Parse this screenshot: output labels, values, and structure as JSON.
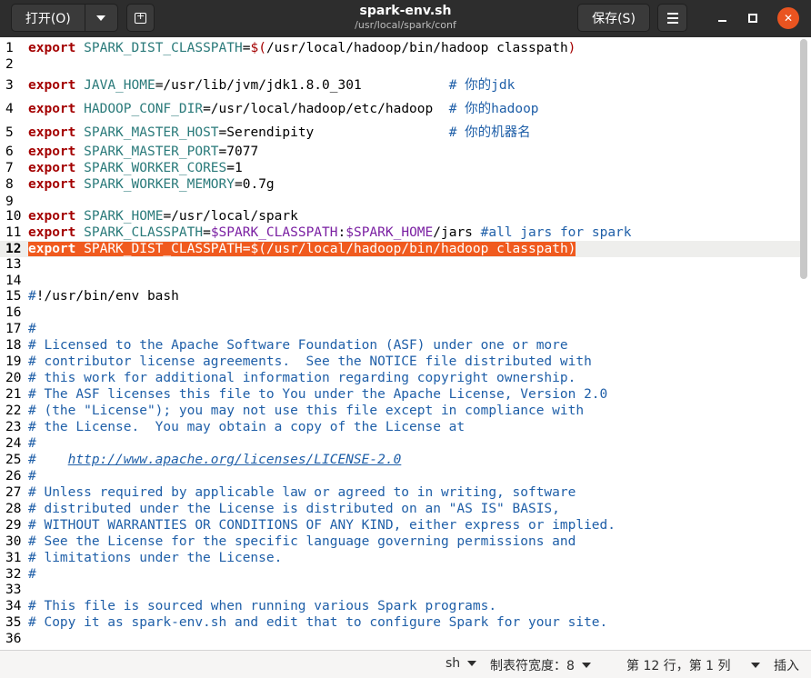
{
  "header": {
    "open_label": "打开(O)",
    "title": "spark-env.sh",
    "subtitle": "/usr/local/spark/conf",
    "save_label": "保存(S)"
  },
  "editor": {
    "current_line": 12,
    "lines": [
      {
        "n": "1",
        "segs": [
          [
            "kw",
            "export"
          ],
          [
            "",
            " "
          ],
          [
            "var",
            "SPARK_DIST_CLASSPATH"
          ],
          [
            "",
            "="
          ],
          [
            "sym",
            "$("
          ],
          [
            "",
            "/usr/local/hadoop/bin/hadoop classpath"
          ],
          [
            "sym",
            ")"
          ]
        ]
      },
      {
        "n": "2",
        "segs": []
      },
      {
        "n": "3",
        "segs": [
          [
            "kw",
            "export"
          ],
          [
            "",
            " "
          ],
          [
            "var",
            "JAVA_HOME"
          ],
          [
            "",
            "=/usr/lib/jvm/jdk1.8.0_301           "
          ],
          [
            "cmt",
            "# 你的jdk"
          ]
        ]
      },
      {
        "n": "4",
        "segs": [
          [
            "kw",
            "export"
          ],
          [
            "",
            " "
          ],
          [
            "var",
            "HADOOP_CONF_DIR"
          ],
          [
            "",
            "=/usr/local/hadoop/etc/hadoop  "
          ],
          [
            "cmt",
            "# 你的hadoop"
          ]
        ]
      },
      {
        "n": "5",
        "segs": [
          [
            "kw",
            "export"
          ],
          [
            "",
            " "
          ],
          [
            "var",
            "SPARK_MASTER_HOST"
          ],
          [
            "",
            "=Serendipity                 "
          ],
          [
            "cmt",
            "# 你的机器名"
          ]
        ]
      },
      {
        "n": "6",
        "segs": [
          [
            "kw",
            "export"
          ],
          [
            "",
            " "
          ],
          [
            "var",
            "SPARK_MASTER_PORT"
          ],
          [
            "",
            "=7077"
          ]
        ]
      },
      {
        "n": "7",
        "segs": [
          [
            "kw",
            "export"
          ],
          [
            "",
            " "
          ],
          [
            "var",
            "SPARK_WORKER_CORES"
          ],
          [
            "",
            "=1"
          ]
        ]
      },
      {
        "n": "8",
        "segs": [
          [
            "kw",
            "export"
          ],
          [
            "",
            " "
          ],
          [
            "var",
            "SPARK_WORKER_MEMORY"
          ],
          [
            "",
            "=0.7g"
          ]
        ]
      },
      {
        "n": "9",
        "segs": []
      },
      {
        "n": "10",
        "segs": [
          [
            "kw",
            "export"
          ],
          [
            "",
            " "
          ],
          [
            "var",
            "SPARK_HOME"
          ],
          [
            "",
            "=/usr/local/spark"
          ]
        ]
      },
      {
        "n": "11",
        "segs": [
          [
            "kw",
            "export"
          ],
          [
            "",
            " "
          ],
          [
            "var",
            "SPARK_CLASSPATH"
          ],
          [
            "",
            "="
          ],
          [
            "dv",
            "$SPARK_CLASSPATH"
          ],
          [
            "",
            ":"
          ],
          [
            "dv",
            "$SPARK_HOME"
          ],
          [
            "",
            "/jars "
          ],
          [
            "cmt",
            "#all jars for spark"
          ]
        ]
      },
      {
        "n": "12",
        "segs": [
          [
            "kw",
            "export"
          ],
          [
            "",
            " "
          ],
          [
            "var",
            "SPARK_DIST_CLASSPATH"
          ],
          [
            "",
            "="
          ],
          [
            "sym",
            "$("
          ],
          [
            "",
            "/usr/local/hadoop/bin/hadoop classpath"
          ],
          [
            "sym",
            ")"
          ]
        ],
        "selected": true
      },
      {
        "n": "13",
        "segs": []
      },
      {
        "n": "14",
        "segs": []
      },
      {
        "n": "15",
        "segs": [
          [
            "cmtg",
            "#"
          ],
          [
            "",
            "!/usr/bin/env bash"
          ]
        ]
      },
      {
        "n": "16",
        "segs": []
      },
      {
        "n": "17",
        "segs": [
          [
            "cmtg",
            "#"
          ]
        ]
      },
      {
        "n": "18",
        "segs": [
          [
            "cmtg",
            "# Licensed to the Apache Software Foundation (ASF) under one or more"
          ]
        ]
      },
      {
        "n": "19",
        "segs": [
          [
            "cmtg",
            "# contributor license agreements.  See the NOTICE file distributed with"
          ]
        ]
      },
      {
        "n": "20",
        "segs": [
          [
            "cmtg",
            "# this work for additional information regarding copyright ownership."
          ]
        ]
      },
      {
        "n": "21",
        "segs": [
          [
            "cmtg",
            "# The ASF licenses this file to You under the Apache License, Version 2.0"
          ]
        ]
      },
      {
        "n": "22",
        "segs": [
          [
            "cmtg",
            "# (the \"License\"); you may not use this file except in compliance with"
          ]
        ]
      },
      {
        "n": "23",
        "segs": [
          [
            "cmtg",
            "# the License.  You may obtain a copy of the License at"
          ]
        ]
      },
      {
        "n": "24",
        "segs": [
          [
            "cmtg",
            "#"
          ]
        ]
      },
      {
        "n": "25",
        "segs": [
          [
            "cmtg",
            "#    "
          ],
          [
            "cmtg url",
            "http://www.apache.org/licenses/LICENSE-2.0"
          ]
        ]
      },
      {
        "n": "26",
        "segs": [
          [
            "cmtg",
            "#"
          ]
        ]
      },
      {
        "n": "27",
        "segs": [
          [
            "cmtg",
            "# Unless required by applicable law or agreed to in writing, software"
          ]
        ]
      },
      {
        "n": "28",
        "segs": [
          [
            "cmtg",
            "# distributed under the License is distributed on an \"AS IS\" BASIS,"
          ]
        ]
      },
      {
        "n": "29",
        "segs": [
          [
            "cmtg",
            "# WITHOUT WARRANTIES OR CONDITIONS OF ANY KIND, either express or implied."
          ]
        ]
      },
      {
        "n": "30",
        "segs": [
          [
            "cmtg",
            "# See the License for the specific language governing permissions and"
          ]
        ]
      },
      {
        "n": "31",
        "segs": [
          [
            "cmtg",
            "# limitations under the License."
          ]
        ]
      },
      {
        "n": "32",
        "segs": [
          [
            "cmtg",
            "#"
          ]
        ]
      },
      {
        "n": "33",
        "segs": []
      },
      {
        "n": "34",
        "segs": [
          [
            "cmtg",
            "# This file is sourced when running various Spark programs."
          ]
        ]
      },
      {
        "n": "35",
        "segs": [
          [
            "cmtg",
            "# Copy it as spark-env.sh and edit that to configure Spark for your site."
          ]
        ]
      },
      {
        "n": "36",
        "segs": []
      }
    ]
  },
  "status": {
    "language": "sh",
    "tab_width": "制表符宽度：8",
    "position": "第 12 行，第 1 列",
    "mode": "插入"
  },
  "colors": {
    "keyword": "#a40000",
    "variable": "#2a7a7a",
    "comment": "#1f5fa8",
    "selection": "#f05a1e",
    "close_button": "#e95420"
  },
  "icons": [
    "chevron-down-icon",
    "new-tab-icon",
    "hamburger-menu-icon",
    "minimize-icon",
    "maximize-icon",
    "close-icon"
  ]
}
